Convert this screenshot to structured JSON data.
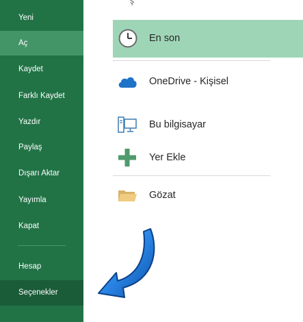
{
  "sidebar": {
    "items": [
      {
        "label": "Yeni"
      },
      {
        "label": "Aç"
      },
      {
        "label": "Kaydet"
      },
      {
        "label": "Farklı Kaydet"
      },
      {
        "label": "Yazdır"
      },
      {
        "label": "Paylaş"
      },
      {
        "label": "Dışarı Aktar"
      },
      {
        "label": "Yayımla"
      },
      {
        "label": "Kapat"
      },
      {
        "label": "Hesap"
      },
      {
        "label": "Seçenekler"
      }
    ],
    "selected": "Aç",
    "highlighted": "Seçenekler"
  },
  "places": {
    "items": [
      {
        "label": "En son",
        "icon": "clock-icon"
      },
      {
        "label": "OneDrive - Kişisel",
        "icon": "cloud-icon"
      },
      {
        "label": "Bu bilgisayar",
        "icon": "computer-icon"
      },
      {
        "label": "Yer Ekle",
        "icon": "plus-icon"
      },
      {
        "label": "Gözat",
        "icon": "folder-icon"
      }
    ],
    "active": "En son"
  },
  "colors": {
    "sidebar_bg": "#217346",
    "sidebar_selected": "#439467",
    "sidebar_highlight": "#1a5c38",
    "active_place": "#9fd5b7",
    "arrow": "#1e6fd0"
  }
}
